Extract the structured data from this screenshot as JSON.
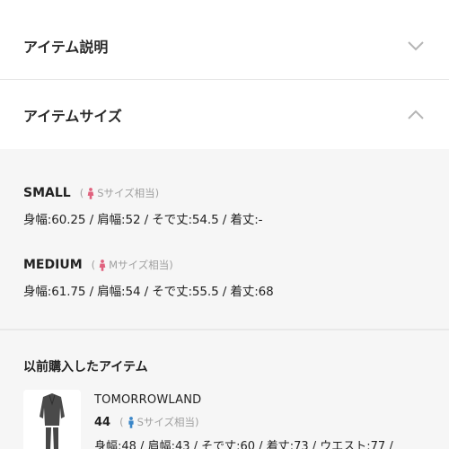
{
  "accordion": {
    "description_label": "アイテム説明",
    "size_label": "アイテムサイズ"
  },
  "sizes": [
    {
      "name": "SMALL",
      "badge_open": "(",
      "badge_text": "Sサイズ相当)",
      "measurements": "身幅:60.25 / 肩幅:52 / そで丈:54.5 / 着丈:-"
    },
    {
      "name": "MEDIUM",
      "badge_open": "(",
      "badge_text": "Mサイズ相当)",
      "measurements": "身幅:61.75 / 肩幅:54 / そで丈:55.5 / 着丈:68"
    }
  ],
  "previous": {
    "title": "以前購入したアイテム",
    "brand": "TOMORROWLAND",
    "size": "44",
    "badge_open": "(",
    "badge_text": "Sサイズ相当)",
    "measurements": "身幅:48 / 肩幅:43 / そで丈:60 / 着丈:73 / ウエスト:77 /"
  },
  "colors": {
    "female_icon": "#e0627e",
    "male_icon": "#3a86c8",
    "chevron": "#b5b5b5",
    "panel_bg": "#f6f6f6"
  },
  "icons": {
    "description_toggle": "chevron-down-icon",
    "size_toggle": "chevron-up-icon",
    "size_small_person": "female-person-icon",
    "size_medium_person": "female-person-icon",
    "previous_person": "male-person-icon"
  }
}
